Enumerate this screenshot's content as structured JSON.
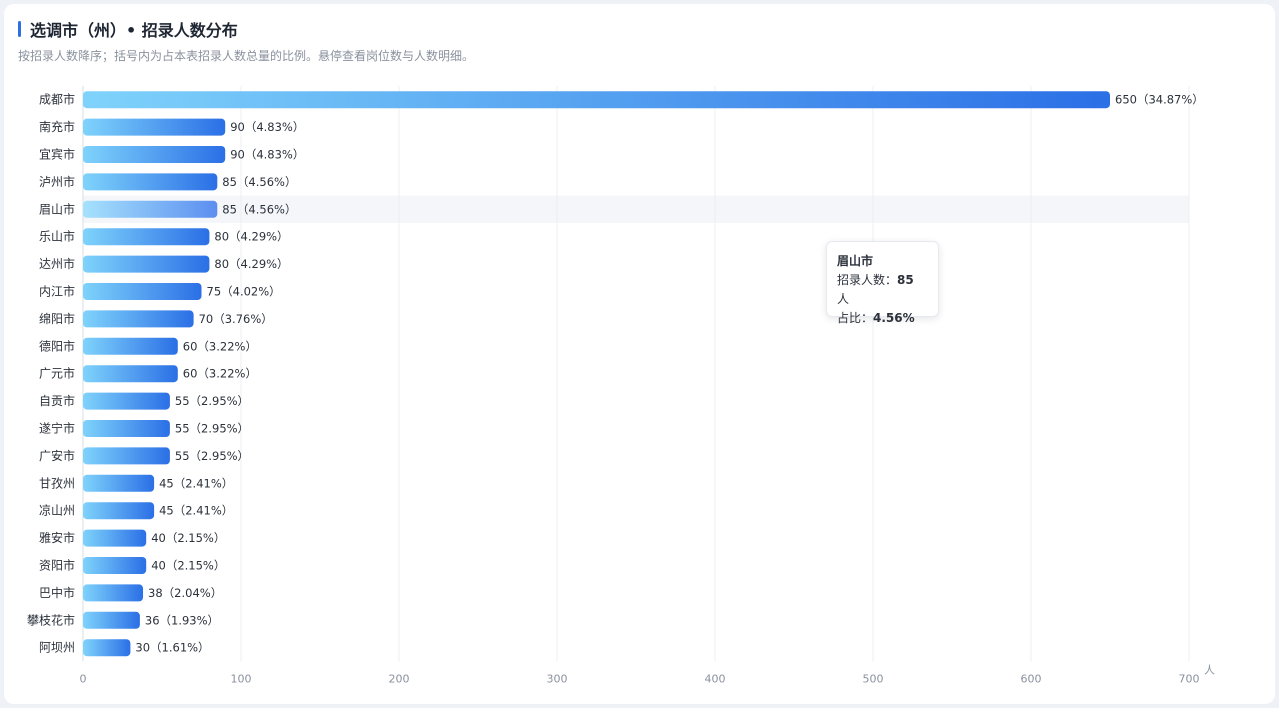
{
  "header": {
    "title": "选调市（州）• 招录人数分布",
    "subtitle": "按招录人数降序；括号内为占本表招录人数总量的比例。悬停查看岗位数与人数明细。"
  },
  "chart_data": {
    "type": "bar",
    "orientation": "horizontal",
    "categories": [
      "成都市",
      "南充市",
      "宜宾市",
      "泸州市",
      "眉山市",
      "乐山市",
      "达州市",
      "内江市",
      "绵阳市",
      "德阳市",
      "广元市",
      "自贡市",
      "遂宁市",
      "广安市",
      "甘孜州",
      "凉山州",
      "雅安市",
      "资阳市",
      "巴中市",
      "攀枝花市",
      "阿坝州"
    ],
    "values": [
      650,
      90,
      90,
      85,
      85,
      80,
      80,
      75,
      70,
      60,
      60,
      55,
      55,
      55,
      45,
      45,
      40,
      40,
      38,
      36,
      30
    ],
    "labels": [
      "650（34.87%）",
      "90（4.83%）",
      "90（4.83%）",
      "85（4.56%）",
      "85（4.56%）",
      "80（4.29%）",
      "80（4.29%）",
      "75（4.02%）",
      "70（3.76%）",
      "60（3.22%）",
      "60（3.22%）",
      "55（2.95%）",
      "55（2.95%）",
      "55（2.95%）",
      "45（2.41%）",
      "45（2.41%）",
      "40（2.15%）",
      "40（2.15%）",
      "38（2.04%）",
      "36（1.93%）",
      "30（1.61%）"
    ],
    "xlim": [
      0,
      700
    ],
    "xticks": [
      0,
      100,
      200,
      300,
      400,
      500,
      600,
      700
    ],
    "xunit": "人",
    "grid": true,
    "highlight_index": 4,
    "colors": {
      "bar_start": "#7fd3fb",
      "bar_end": "#2b6fe6",
      "highlight_start": "#a6e2fc",
      "highlight_end": "#5b8ef0",
      "grid": "#eceff3",
      "axis_text": "#8a929e",
      "label_text": "#2b313b"
    }
  },
  "tooltip": {
    "title": "眉山市",
    "count_label": "招录人数：",
    "count_value": "85",
    "count_unit": " 人",
    "ratio_label": "占比：",
    "ratio_value": "4.56%"
  }
}
